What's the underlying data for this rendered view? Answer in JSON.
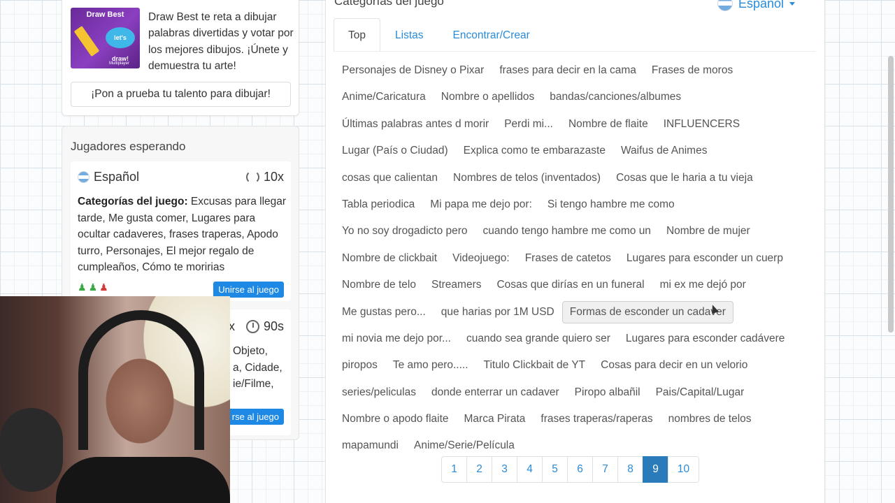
{
  "promo": {
    "thumb_title": "Draw Best",
    "thumb_bubble": "let's draw!",
    "thumb_brand": "Multiplayer",
    "text": "Draw Best te reta a dibujar palabras divertidas y votar por los mejores dibujos. ¡Únete y demuestra tu arte!",
    "button_label": "¡Pon a prueba tu talento para dibujar!"
  },
  "waiting": {
    "title": "Jugadores esperando",
    "rooms": [
      {
        "language": "Español",
        "rounds": "10x",
        "categories_label": "Categorías del juego:",
        "categories_text": " Excusas para llegar tarde, Me gusta comer, Lugares para ocultar cadaveres, frases traperas, Apodo turro, Personajes, El mejor regalo de cumpleaños, Cómo te moririas",
        "players": [
          "green",
          "green",
          "red"
        ],
        "join_label": "Unirse al juego"
      },
      {
        "rounds": "x",
        "time": "90s",
        "categories_lines": [
          "Objeto,",
          "a, Cidade,",
          "ie/Filme,"
        ],
        "join_label": "rse al juego"
      }
    ]
  },
  "main": {
    "title": "Categorías del juego",
    "language": "Español",
    "tabs": [
      {
        "label": "Top",
        "active": true
      },
      {
        "label": "Listas",
        "active": false
      },
      {
        "label": "Encontrar/Crear",
        "active": false
      }
    ],
    "categories": [
      "Personajes de Disney o Pixar",
      "frases para decir en la cama",
      "Frases de moros",
      "Anime/Caricatura",
      "Nombre o apellidos",
      "bandas/canciones/albumes",
      "Últimas palabras antes d morir",
      "Perdi mi...",
      "Nombre de flaite",
      "INFLUENCERS",
      "Lugar (País o Ciudad)",
      "Explica como te embarazaste",
      "Waifus de Animes",
      "cosas que calientan",
      "Nombres de telos (inventados)",
      "Cosas que le haria a tu vieja",
      "Tabla periodica",
      "Mi papa me dejo por:",
      "Si tengo hambre me como",
      "Yo no soy drogadicto pero",
      "cuando tengo hambre me como un",
      "Nombre de mujer",
      "Nombre de clickbait",
      "Videojuego:",
      "Frases de catetos",
      "Lugares para esconder un cuerp",
      "Nombre de telo",
      "Streamers",
      "Cosas que dirías en un funeral",
      "mi ex me dejó por",
      "Me gustas pero...",
      "que harias por 1M USD",
      "Formas de esconder un cadaver",
      "mi novia me dejo por...",
      "cuando sea grande quiero ser",
      "Lugares para esconder cadávere",
      "piropos",
      "Te amo pero.....",
      "Titulo Clickbait de YT",
      "Cosas para decir en un velorio",
      "series/peliculas",
      "donde enterrar un cadaver",
      "Piropo albañil",
      "Pais/Capital/Lugar",
      "Nombre o apodo flaite",
      "Marca Pirata",
      "frases traperas/raperas",
      "nombres de telos",
      "mapamundi",
      "Anime/Serie/Película"
    ],
    "hovered_category": "Formas de esconder un cadaver",
    "pages": [
      "1",
      "2",
      "3",
      "4",
      "5",
      "6",
      "7",
      "8",
      "9",
      "10"
    ],
    "active_page": "9"
  },
  "colors": {
    "accent": "#2a8bd8",
    "active_page": "#2a7bb9",
    "join_button": "#1e88e5"
  }
}
